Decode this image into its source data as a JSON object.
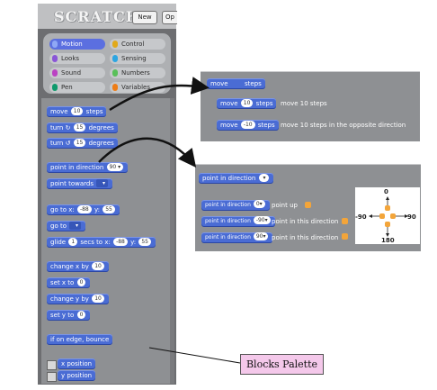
{
  "app": {
    "logo": "SCRATCH",
    "new_button": "New",
    "open_button": "Op"
  },
  "categories": [
    {
      "label": "Motion",
      "color": "#4a6cd4",
      "selected": true
    },
    {
      "label": "Control",
      "color": "#e1a91a"
    },
    {
      "label": "Looks",
      "color": "#8a55d7"
    },
    {
      "label": "Sensing",
      "color": "#2ca5e2"
    },
    {
      "label": "Sound",
      "color": "#bb42c3"
    },
    {
      "label": "Numbers",
      "color": "#59c059"
    },
    {
      "label": "Pen",
      "color": "#0e9a6c"
    },
    {
      "label": "Variables",
      "color": "#ee7d16"
    }
  ],
  "blocks": {
    "move": {
      "pre": "move",
      "val": "10",
      "post": "steps"
    },
    "turn_right": {
      "pre": "turn",
      "icon": "↻",
      "val": "15",
      "post": "degrees"
    },
    "turn_left": {
      "pre": "turn",
      "icon": "↺",
      "val": "15",
      "post": "degrees"
    },
    "point_direction": {
      "pre": "point in direction",
      "val": "90"
    },
    "point_towards": {
      "pre": "point towards"
    },
    "goto_xy": {
      "pre": "go to x:",
      "x": "-88",
      "mid": "y:",
      "y": "55"
    },
    "goto": {
      "pre": "go to"
    },
    "glide": {
      "pre": "glide",
      "secs": "1",
      "mid1": "secs to x:",
      "x": "-88",
      "mid2": "y:",
      "y": "55"
    },
    "change_x": {
      "pre": "change x by",
      "val": "10"
    },
    "set_x": {
      "pre": "set x to",
      "val": "0"
    },
    "change_y": {
      "pre": "change y by",
      "val": "10"
    },
    "set_y": {
      "pre": "set y to",
      "val": "0"
    },
    "bounce": {
      "pre": "if on edge, bounce"
    },
    "x_position": "x position",
    "y_position": "y position"
  },
  "callout_move": {
    "header": {
      "pre": "move",
      "post": "steps"
    },
    "row1": {
      "pre": "move",
      "val": "10",
      "post": "steps",
      "desc": "move 10 steps"
    },
    "row2": {
      "pre": "move",
      "val": "-10",
      "post": "steps",
      "desc": "move 10 steps in the opposite direction"
    }
  },
  "callout_direction": {
    "header": {
      "pre": "point in direction"
    },
    "rows": [
      {
        "pre": "point in direction",
        "val": "0",
        "desc": "point up"
      },
      {
        "pre": "point in direction",
        "val": "-90",
        "desc": "point in this direction"
      },
      {
        "pre": "point in direction",
        "val": "90",
        "desc": "point in this direction"
      }
    ],
    "dial": {
      "top": "0",
      "left": "-90",
      "right": "90",
      "bottom": "180"
    }
  },
  "label": "Blocks Palette"
}
